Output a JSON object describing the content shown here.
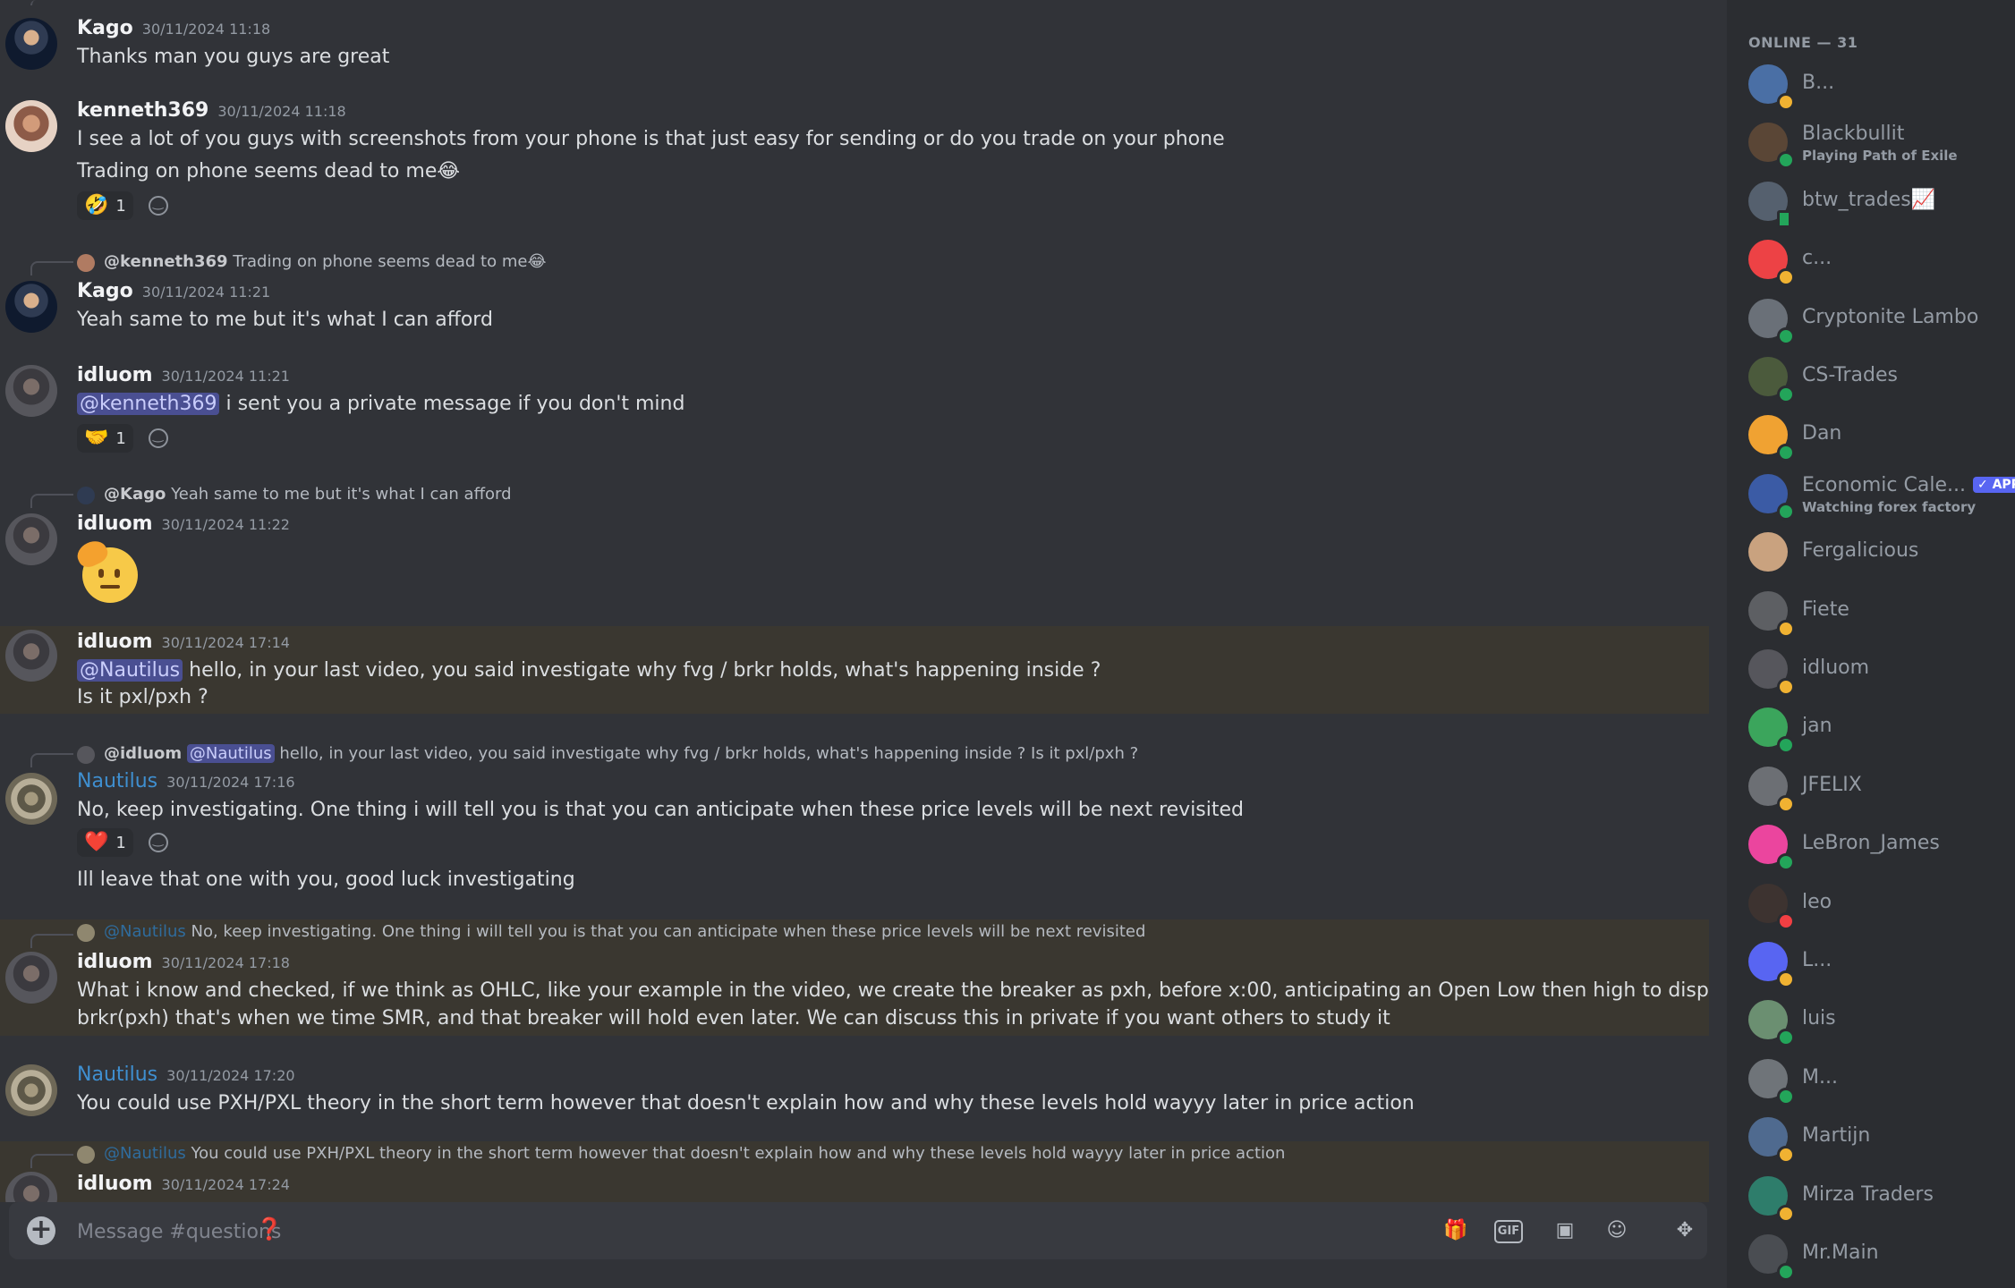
{
  "composer": {
    "placeholder": "Message #questions",
    "placeholder_emoji": "❓",
    "gif_label": "GIF"
  },
  "messages": [
    {
      "author": "Kago",
      "timestamp": "30/11/2024 11:18",
      "lines": [
        "Thanks man you guys are great"
      ]
    },
    {
      "author": "kenneth369",
      "timestamp": "30/11/2024 11:18",
      "lines": [
        "I see a lot of you guys with screenshots from your phone is that just easy for sending or do you trade on your phone",
        "Trading on phone seems dead to me😂"
      ],
      "reactions": [
        {
          "emoji": "🤣",
          "count": "1"
        }
      ]
    },
    {
      "reply_to": {
        "author": "@kenneth369",
        "text": "Trading on phone seems dead to me😂"
      },
      "author": "Kago",
      "timestamp": "30/11/2024 11:21",
      "lines": [
        "Yeah same to me but it's what I can afford"
      ]
    },
    {
      "author": "idluom",
      "timestamp": "30/11/2024 11:21",
      "mention": "@kenneth369",
      "lines": [
        "i sent you a private message if you don't mind"
      ],
      "reactions": [
        {
          "emoji": "🤝",
          "count": "1"
        }
      ]
    },
    {
      "reply_to": {
        "author": "@Kago",
        "text": "Yeah same to me but it's what I can afford"
      },
      "author": "idluom",
      "timestamp": "30/11/2024 11:22",
      "big_emoji": "saluting-face"
    },
    {
      "author": "idluom",
      "timestamp": "30/11/2024 17:14",
      "mention": "@Nautilus",
      "lines": [
        "hello, in your last video, you said investigate why fvg / brkr holds, what's happening inside ?",
        "Is it pxl/pxh ?"
      ]
    },
    {
      "reply_to": {
        "author": "@idluom",
        "mention": "@Nautilus",
        "text": "hello, in your last video, you said investigate why fvg / brkr holds, what's happening inside ?  Is it pxl/pxh ?"
      },
      "author": "Nautilus",
      "timestamp": "30/11/2024 17:16",
      "lines": [
        "No, keep investigating. One thing i will tell you is that you can anticipate when these price levels will be next revisited"
      ],
      "reactions": [
        {
          "emoji": "❤️",
          "count": "1"
        }
      ],
      "followup": "Ill leave that one with you, good luck investigating"
    },
    {
      "reply_to": {
        "author": "@Nautilus",
        "text": "No, keep investigating. One thing i will tell you is that you can anticipate when these price levels will be next revisited"
      },
      "author": "idluom",
      "timestamp": "30/11/2024 17:18",
      "lines": [
        "What i know and checked, if we think as OHLC, like your example in the video, we create the breaker as pxh, before x:00, anticipating an Open Low then high to displace above the",
        "brkr(pxh) that's when we time SMR, and that breaker will hold even later. We can discuss this in private if you want others to study it"
      ]
    },
    {
      "author": "Nautilus",
      "timestamp": "30/11/2024 17:20",
      "lines": [
        "You could use PXH/PXL theory in the short term however that doesn't explain how and why these levels hold wayyy later in price action"
      ]
    },
    {
      "reply_to": {
        "author": "@Nautilus",
        "text": "You could use PXH/PXL theory in the short term however that doesn't explain how and why these levels hold wayyy later in price action"
      },
      "author": "idluom",
      "timestamp": "30/11/2024 17:24"
    }
  ],
  "members": {
    "header": "ONLINE — 31",
    "items": [
      {
        "name": "B...",
        "status": "idle",
        "color": "#4a6fa5"
      },
      {
        "name": "Blackbullit",
        "sub": "Playing Path of Exile",
        "status": "online",
        "color": "#5a4636"
      },
      {
        "name": "btw_trades📈",
        "status": "mobile",
        "color": "#55606e"
      },
      {
        "name": "c...",
        "status": "idle",
        "color": "#ed4245"
      },
      {
        "name": "Cryptonite Lambo",
        "status": "online",
        "color": "#6a7078"
      },
      {
        "name": "CS-Trades",
        "status": "online",
        "color": "#4b5a3c"
      },
      {
        "name": "Dan",
        "status": "online",
        "color": "#f0a232"
      },
      {
        "name": "Economic Cale...",
        "badge": "✓ APP",
        "sub": "Watching forex factory",
        "status": "online",
        "color": "#3b5ba5"
      },
      {
        "name": "Fergalicious",
        "status": "none",
        "color": "#c9a27f"
      },
      {
        "name": "Fiete",
        "status": "idle",
        "color": "#5d5f63"
      },
      {
        "name": "idluom",
        "status": "idle",
        "color": "#56565c"
      },
      {
        "name": "jan",
        "status": "online",
        "color": "#3ba55c"
      },
      {
        "name": "JFELIX",
        "status": "idle",
        "color": "#6c6f74"
      },
      {
        "name": "LeBron_James",
        "status": "online",
        "color": "#eb459e"
      },
      {
        "name": "leo",
        "status": "dnd",
        "color": "#3d3330"
      },
      {
        "name": "L...",
        "status": "idle",
        "color": "#5865f2"
      },
      {
        "name": "luis",
        "status": "online",
        "color": "#6b8f71"
      },
      {
        "name": "M...",
        "status": "online",
        "color": "#6f7479"
      },
      {
        "name": "Martijn",
        "status": "idle",
        "color": "#4f6a8f"
      },
      {
        "name": "Mirza Traders",
        "status": "idle",
        "color": "#2e7d6b"
      },
      {
        "name": "Mr.Main",
        "status": "online",
        "color": "#4a4d52"
      }
    ]
  },
  "status_colors": {
    "online": "#23a55a",
    "idle": "#f0b232",
    "dnd": "#f23f43",
    "mobile": "#23a55a"
  }
}
